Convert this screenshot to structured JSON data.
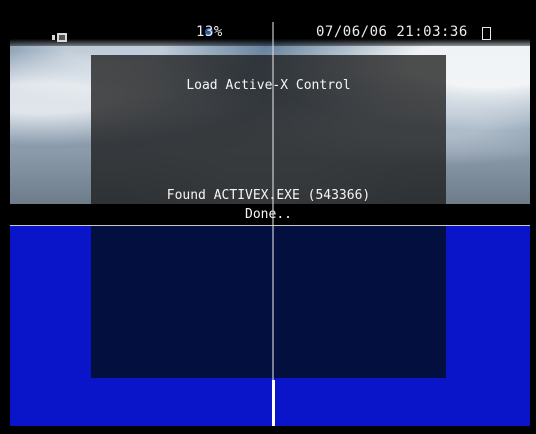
{
  "status": {
    "signal_text": "13%",
    "datetime_text": "07/06/06 21:03:36"
  },
  "dialog": {
    "title": "Load Active-X Control",
    "found_text": "Found ACTIVEX.EXE (543366)",
    "done_text": "Done.."
  },
  "colors": {
    "blue_background": "#0a14c8",
    "panel_navy": "#03103f"
  },
  "icons": {
    "tv": "tv-icon"
  }
}
